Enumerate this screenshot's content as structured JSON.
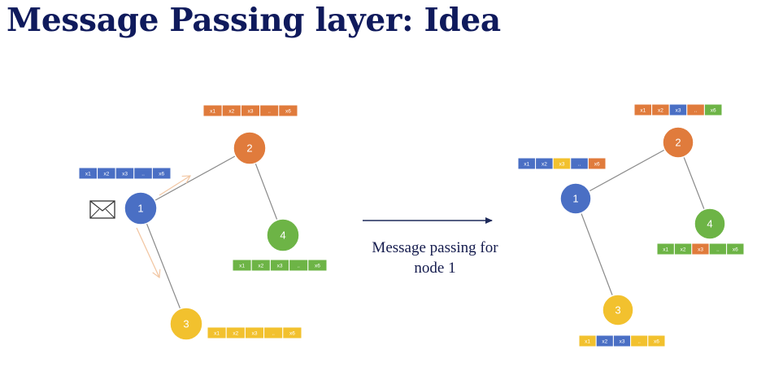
{
  "title": "Message Passing layer: Idea",
  "caption": {
    "line1": "Message passing for",
    "line2": "node 1"
  },
  "colors": {
    "title": "#0f1a5c",
    "blue": "#4a6fc4",
    "orange": "#e07b3c",
    "green": "#6db446",
    "yellow": "#f2c12e",
    "edge": "#8a8a8a",
    "message_arrow": "#f2c7a4",
    "main_arrow": "#1e2a5a"
  },
  "icons": {
    "message": "envelope-icon",
    "transition": "arrow-right-icon"
  },
  "feature_labels": [
    "x1",
    "x2",
    "x3",
    "..",
    "x6"
  ],
  "before": {
    "nodes": [
      {
        "id": "1",
        "color": "blue"
      },
      {
        "id": "2",
        "color": "orange"
      },
      {
        "id": "3",
        "color": "yellow"
      },
      {
        "id": "4",
        "color": "green"
      }
    ],
    "edges": [
      [
        "1",
        "2"
      ],
      [
        "1",
        "3"
      ],
      [
        "2",
        "4"
      ]
    ],
    "messages_into": "1",
    "features": {
      "1": [
        "blue",
        "blue",
        "blue",
        "blue",
        "blue"
      ],
      "2": [
        "orange",
        "orange",
        "orange",
        "orange",
        "orange"
      ],
      "3": [
        "yellow",
        "yellow",
        "yellow",
        "yellow",
        "yellow"
      ],
      "4": [
        "green",
        "green",
        "green",
        "green",
        "green"
      ]
    }
  },
  "after": {
    "nodes": [
      {
        "id": "1",
        "color": "blue"
      },
      {
        "id": "2",
        "color": "orange"
      },
      {
        "id": "3",
        "color": "yellow"
      },
      {
        "id": "4",
        "color": "green"
      }
    ],
    "edges": [
      [
        "1",
        "2"
      ],
      [
        "1",
        "3"
      ],
      [
        "2",
        "4"
      ]
    ],
    "features": {
      "1": [
        "blue",
        "blue",
        "yellow",
        "blue",
        "orange"
      ],
      "2": [
        "orange",
        "orange",
        "blue",
        "orange",
        "green"
      ],
      "3": [
        "yellow",
        "blue",
        "blue",
        "yellow",
        "yellow"
      ],
      "4": [
        "green",
        "green",
        "orange",
        "green",
        "green"
      ]
    }
  }
}
